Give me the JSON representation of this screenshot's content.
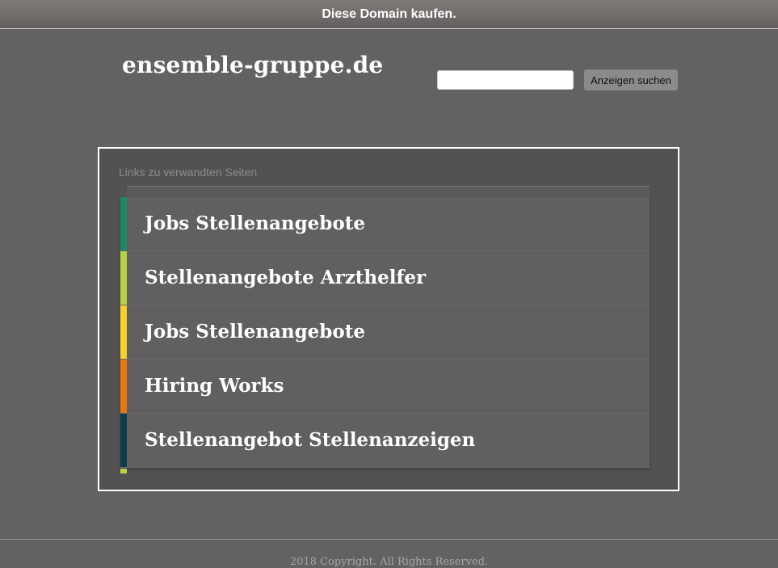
{
  "topbar": {
    "buy_domain_label": "Diese Domain kaufen."
  },
  "header": {
    "site_title": "ensemble-gruppe.de",
    "search_value": "",
    "search_button_label": "Anzeigen suchen"
  },
  "related": {
    "heading": "Links zu verwandten Seiten",
    "links": [
      {
        "label": "Jobs Stellenangebote",
        "accent": "#1d8a66"
      },
      {
        "label": "Stellenangebote Arzthelfer",
        "accent": "#b7d343"
      },
      {
        "label": "Jobs Stellenangebote",
        "accent": "#f5d22a"
      },
      {
        "label": "Hiring Works",
        "accent": "#e8770f"
      },
      {
        "label": "Stellenangebot Stellenanzeigen",
        "accent": "#0d3b4a"
      }
    ]
  },
  "footer": {
    "copyright": "2018 Copyright. All Rights Reserved."
  }
}
